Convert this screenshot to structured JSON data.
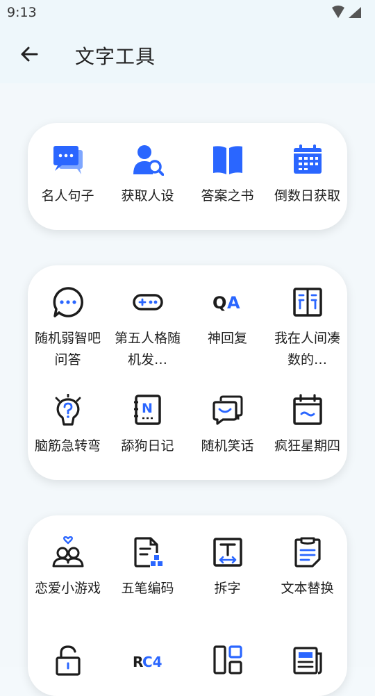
{
  "status_bar": {
    "time": "9:13"
  },
  "app_bar": {
    "title": "文字工具"
  },
  "card1": {
    "items": [
      {
        "label": "名人句子",
        "icon": "chat-bubbles-icon"
      },
      {
        "label": "获取人设",
        "icon": "user-search-icon"
      },
      {
        "label": "答案之书",
        "icon": "open-book-icon"
      },
      {
        "label": "倒数日获取",
        "icon": "calendar-icon"
      }
    ]
  },
  "card2": {
    "items": [
      {
        "label": "随机弱智吧问答",
        "icon": "chat-dots-icon"
      },
      {
        "label": "第五人格随机发…",
        "icon": "gamepad-icon"
      },
      {
        "label": "神回复",
        "icon": "qa-icon"
      },
      {
        "label": "我在人间凑数的…",
        "icon": "book-columns-icon"
      },
      {
        "label": "脑筋急转弯",
        "icon": "lightbulb-question-icon"
      },
      {
        "label": "舔狗日记",
        "icon": "notebook-n-icon"
      },
      {
        "label": "随机笑话",
        "icon": "smile-chat-icon"
      },
      {
        "label": "疯狂星期四",
        "icon": "calendar-wave-icon"
      }
    ]
  },
  "card3": {
    "items": [
      {
        "label": "恋爱小游戏",
        "icon": "couple-heart-icon"
      },
      {
        "label": "五笔编码",
        "icon": "document-blocks-icon"
      },
      {
        "label": "拆字",
        "icon": "text-box-icon"
      },
      {
        "label": "文本替换",
        "icon": "clipboard-lines-icon"
      },
      {
        "label": "",
        "icon": "lock-icon"
      },
      {
        "label": "",
        "icon": "rc4-icon"
      },
      {
        "label": "",
        "icon": "layout-blocks-icon"
      },
      {
        "label": "",
        "icon": "newspaper-icon"
      }
    ]
  },
  "colors": {
    "accent": "#2a66ff",
    "dark": "#1c1c1c"
  }
}
